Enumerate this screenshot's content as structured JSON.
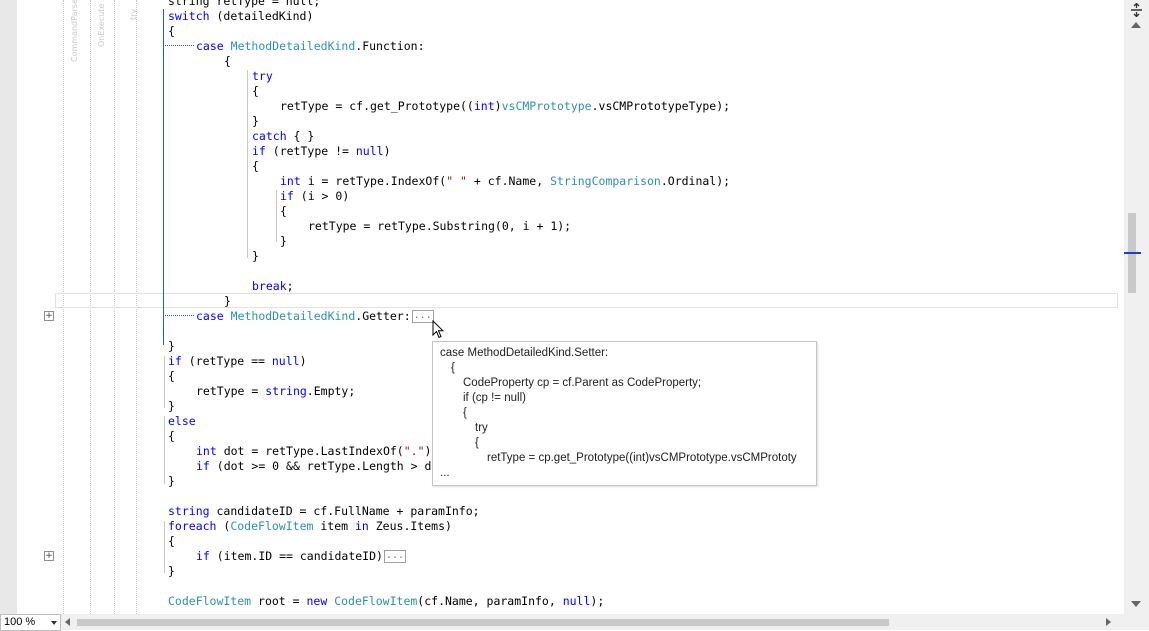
{
  "editor": {
    "gutter_labels": [
      "CommandParse",
      "OnExecute",
      "try"
    ],
    "lines": [
      {
        "parts": [
          [
            "",
            "string retType = null;"
          ]
        ]
      },
      {
        "parts": [
          [
            "kw",
            "switch"
          ],
          [
            "",
            " (detailedKind)"
          ]
        ]
      },
      {
        "parts": [
          [
            "",
            "{"
          ]
        ]
      },
      {
        "parts": [
          [
            "kw",
            "case"
          ],
          [
            "",
            " "
          ],
          [
            "ty",
            "MethodDetailedKind"
          ],
          [
            "",
            ".Function:"
          ]
        ]
      },
      {
        "parts": [
          [
            "",
            "{"
          ]
        ]
      },
      {
        "parts": [
          [
            "kw",
            "try"
          ]
        ]
      },
      {
        "parts": [
          [
            "",
            "{"
          ]
        ]
      },
      {
        "parts": [
          [
            "",
            "retType = cf.get_Prototype(("
          ],
          [
            "kw",
            "int"
          ],
          [
            "",
            ")"
          ],
          [
            "ty",
            "vsCMPrototype"
          ],
          [
            "",
            ".vsCMPrototypeType);"
          ]
        ]
      },
      {
        "parts": [
          [
            "",
            "}"
          ]
        ]
      },
      {
        "parts": [
          [
            "kw",
            "catch"
          ],
          [
            "",
            " { }"
          ]
        ]
      },
      {
        "parts": [
          [
            "kw",
            "if"
          ],
          [
            "",
            " (retType != "
          ],
          [
            "kw",
            "null"
          ],
          [
            "",
            ")"
          ]
        ]
      },
      {
        "parts": [
          [
            "",
            "{"
          ]
        ]
      },
      {
        "parts": [
          [
            "kw",
            "int"
          ],
          [
            "",
            " i = retType.IndexOf("
          ],
          [
            "str",
            "\" \""
          ],
          [
            "",
            " + cf.Name, "
          ],
          [
            "ty",
            "StringComparison"
          ],
          [
            "",
            ".Ordinal);"
          ]
        ]
      },
      {
        "parts": [
          [
            "kw",
            "if"
          ],
          [
            "",
            " (i > 0)"
          ]
        ]
      },
      {
        "parts": [
          [
            "",
            "{"
          ]
        ]
      },
      {
        "parts": [
          [
            "",
            "retType = retType.Substring(0, i + 1);"
          ]
        ]
      },
      {
        "parts": [
          [
            "",
            "}"
          ]
        ]
      },
      {
        "parts": [
          [
            "",
            "}"
          ]
        ]
      },
      {
        "parts": [
          [
            "kw",
            "break"
          ],
          [
            "",
            ";"
          ]
        ]
      },
      {
        "parts": [
          [
            "",
            "}"
          ]
        ]
      },
      {
        "parts": [
          [
            "kw",
            "case"
          ],
          [
            "",
            " "
          ],
          [
            "ty",
            "MethodDetailedKind"
          ],
          [
            "",
            ".Getter:"
          ]
        ],
        "collapsed": "..."
      },
      {
        "parts": [
          [
            "",
            "}"
          ]
        ]
      },
      {
        "parts": [
          [
            "kw",
            "if"
          ],
          [
            "",
            " (retType == "
          ],
          [
            "kw",
            "null"
          ],
          [
            "",
            ")"
          ]
        ]
      },
      {
        "parts": [
          [
            "",
            "{"
          ]
        ]
      },
      {
        "parts": [
          [
            "",
            "retType = "
          ],
          [
            "kw",
            "string"
          ],
          [
            "",
            ".Empty;"
          ]
        ]
      },
      {
        "parts": [
          [
            "",
            "}"
          ]
        ]
      },
      {
        "parts": [
          [
            "kw",
            "else"
          ]
        ]
      },
      {
        "parts": [
          [
            "",
            "{"
          ]
        ]
      },
      {
        "parts": [
          [
            "kw",
            "int"
          ],
          [
            "",
            " dot = retType.LastIndexOf("
          ],
          [
            "str",
            "\".\""
          ],
          [
            "",
            ")"
          ]
        ]
      },
      {
        "parts": [
          [
            "kw",
            "if"
          ],
          [
            "",
            " (dot >= 0 && retType.Length > d"
          ]
        ]
      },
      {
        "parts": [
          [
            "",
            "}"
          ]
        ]
      },
      {
        "parts": [
          [
            "kw",
            "string"
          ],
          [
            "",
            " candidateID = cf.FullName + paramInfo;"
          ]
        ]
      },
      {
        "parts": [
          [
            "kw",
            "foreach"
          ],
          [
            "",
            " ("
          ],
          [
            "ty",
            "CodeFlowItem"
          ],
          [
            "",
            " item "
          ],
          [
            "kw",
            "in"
          ],
          [
            "",
            " Zeus.Items)"
          ]
        ]
      },
      {
        "parts": [
          [
            "",
            "{"
          ]
        ]
      },
      {
        "parts": [
          [
            "kw",
            "if"
          ],
          [
            "",
            " (item.ID == candidateID)"
          ]
        ],
        "collapsed": "..."
      },
      {
        "parts": [
          [
            "",
            "}"
          ]
        ]
      },
      {
        "parts": [
          [
            "ty",
            "CodeFlowItem"
          ],
          [
            "",
            " root = "
          ],
          [
            "kw",
            "new"
          ],
          [
            "",
            " "
          ],
          [
            "ty",
            "CodeFlowItem"
          ],
          [
            "",
            "(cf.Name, paramInfo, "
          ],
          [
            "kw",
            "null"
          ],
          [
            "",
            ");"
          ]
        ]
      }
    ]
  },
  "tooltip": {
    "lines": [
      "case MethodDetailedKind.Setter:",
      "{",
      "CodeProperty cp = cf.Parent as CodeProperty;",
      "if (cp != null)",
      "{",
      "try",
      "{",
      "retType = cp.get_Prototype((int)vsCMPrototype.vsCMPrototy",
      "..."
    ]
  },
  "statusbar": {
    "zoom": "100 %"
  },
  "icons": {
    "expand": "plus-box-icon",
    "split": "split-handle-icon",
    "cursor": "mouse-pointer-icon"
  }
}
